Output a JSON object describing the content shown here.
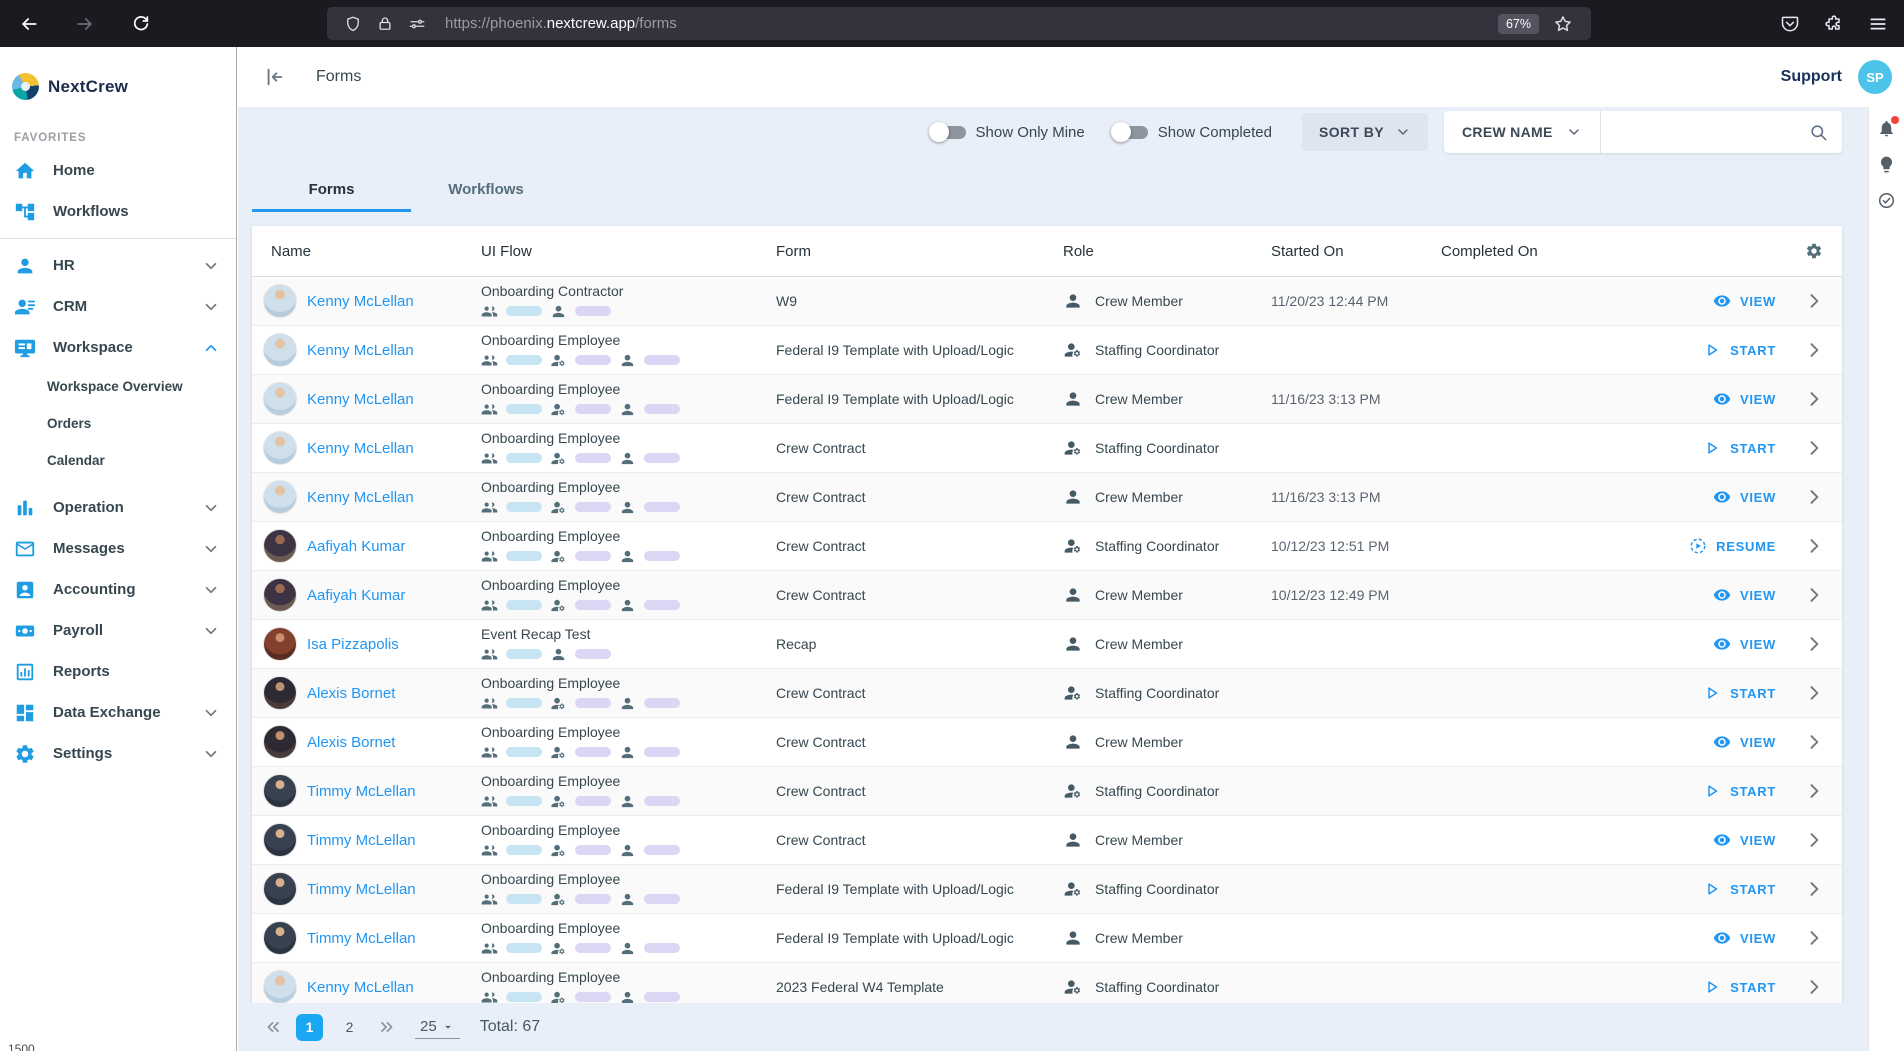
{
  "browser": {
    "url_prefix": "https://phoenix.",
    "url_domain": "nextcrew.app",
    "url_path": "/forms",
    "zoom_badge": "67%"
  },
  "sidebar": {
    "brand": "NextCrew",
    "section_label": "FAVORITES",
    "items": [
      {
        "id": "home",
        "label": "Home",
        "icon": "home",
        "chevron": "none"
      },
      {
        "id": "workflows",
        "label": "Workflows",
        "icon": "workflows",
        "chevron": "none",
        "divider_after": true
      },
      {
        "id": "hr",
        "label": "HR",
        "icon": "person",
        "chevron": "down"
      },
      {
        "id": "crm",
        "label": "CRM",
        "icon": "crm",
        "chevron": "down"
      },
      {
        "id": "workspace",
        "label": "Workspace",
        "icon": "workspace",
        "chevron": "up",
        "children": [
          "Workspace Overview",
          "Orders",
          "Calendar"
        ]
      },
      {
        "id": "operation",
        "label": "Operation",
        "icon": "operation",
        "chevron": "down"
      },
      {
        "id": "messages",
        "label": "Messages",
        "icon": "messages",
        "chevron": "down"
      },
      {
        "id": "accounting",
        "label": "Accounting",
        "icon": "accounting",
        "chevron": "down"
      },
      {
        "id": "payroll",
        "label": "Payroll",
        "icon": "payroll",
        "chevron": "down"
      },
      {
        "id": "reports",
        "label": "Reports",
        "icon": "reports",
        "chevron": "none"
      },
      {
        "id": "data-exchange",
        "label": "Data Exchange",
        "icon": "data-exchange",
        "chevron": "down"
      },
      {
        "id": "settings",
        "label": "Settings",
        "icon": "settings",
        "chevron": "down"
      }
    ]
  },
  "header": {
    "title": "Forms",
    "support_label": "Support",
    "avatar_initials": "SP"
  },
  "filters": {
    "toggles": [
      {
        "label": "Show Only Mine",
        "on": false
      },
      {
        "label": "Show Completed",
        "on": false
      }
    ],
    "sort_button_label": "SORT BY",
    "search_field_label": "CREW NAME",
    "search_value": ""
  },
  "tabs": [
    {
      "label": "Forms",
      "active": true
    },
    {
      "label": "Workflows",
      "active": false
    }
  ],
  "table": {
    "columns": [
      "Name",
      "UI Flow",
      "Form",
      "Role",
      "Started On",
      "Completed On"
    ],
    "flows": {
      "contractor": {
        "title": "Onboarding Contractor",
        "steps": [
          "group-icon",
          "bar-blue",
          "person-icon",
          "bar-purple"
        ]
      },
      "employee": {
        "title": "Onboarding Employee",
        "steps": [
          "group-icon",
          "bar-blue",
          "person-gear-icon",
          "bar-purple",
          "person-icon",
          "bar-purple"
        ]
      },
      "recap": {
        "title": "Event Recap Test",
        "steps": [
          "group-icon",
          "bar-blue",
          "person-icon",
          "bar-purple"
        ]
      }
    },
    "rows": [
      {
        "name": "Kenny McLellan",
        "person": "kenny",
        "flow": "contractor",
        "form": "W9",
        "role": "Crew Member",
        "role_icon": "person",
        "started": "11/20/23 12:44 PM",
        "completed": "",
        "action": "view",
        "action_label": "VIEW"
      },
      {
        "name": "Kenny McLellan",
        "person": "kenny",
        "flow": "employee",
        "form": "Federal I9 Template with Upload/Logic",
        "role": "Staffing Coordinator",
        "role_icon": "person-gear",
        "started": "",
        "completed": "",
        "action": "start",
        "action_label": "START"
      },
      {
        "name": "Kenny McLellan",
        "person": "kenny",
        "flow": "employee",
        "form": "Federal I9 Template with Upload/Logic",
        "role": "Crew Member",
        "role_icon": "person",
        "started": "11/16/23 3:13 PM",
        "completed": "",
        "action": "view",
        "action_label": "VIEW"
      },
      {
        "name": "Kenny McLellan",
        "person": "kenny",
        "flow": "employee",
        "form": "Crew Contract",
        "role": "Staffing Coordinator",
        "role_icon": "person-gear",
        "started": "",
        "completed": "",
        "action": "start",
        "action_label": "START"
      },
      {
        "name": "Kenny McLellan",
        "person": "kenny",
        "flow": "employee",
        "form": "Crew Contract",
        "role": "Crew Member",
        "role_icon": "person",
        "started": "11/16/23 3:13 PM",
        "completed": "",
        "action": "view",
        "action_label": "VIEW"
      },
      {
        "name": "Aafiyah Kumar",
        "person": "aafiyah",
        "flow": "employee",
        "form": "Crew Contract",
        "role": "Staffing Coordinator",
        "role_icon": "person-gear",
        "started": "10/12/23 12:51 PM",
        "completed": "",
        "action": "resume",
        "action_label": "RESUME"
      },
      {
        "name": "Aafiyah Kumar",
        "person": "aafiyah",
        "flow": "employee",
        "form": "Crew Contract",
        "role": "Crew Member",
        "role_icon": "person",
        "started": "10/12/23 12:49 PM",
        "completed": "",
        "action": "view",
        "action_label": "VIEW"
      },
      {
        "name": "Isa Pizzapolis",
        "person": "isa",
        "flow": "recap",
        "form": "Recap",
        "role": "Crew Member",
        "role_icon": "person",
        "started": "",
        "completed": "",
        "action": "view",
        "action_label": "VIEW"
      },
      {
        "name": "Alexis Bornet",
        "person": "alexis",
        "flow": "employee",
        "form": "Crew Contract",
        "role": "Staffing Coordinator",
        "role_icon": "person-gear",
        "started": "",
        "completed": "",
        "action": "start",
        "action_label": "START"
      },
      {
        "name": "Alexis Bornet",
        "person": "alexis",
        "flow": "employee",
        "form": "Crew Contract",
        "role": "Crew Member",
        "role_icon": "person",
        "started": "",
        "completed": "",
        "action": "view",
        "action_label": "VIEW"
      },
      {
        "name": "Timmy McLellan",
        "person": "timmy",
        "flow": "employee",
        "form": "Crew Contract",
        "role": "Staffing Coordinator",
        "role_icon": "person-gear",
        "started": "",
        "completed": "",
        "action": "start",
        "action_label": "START"
      },
      {
        "name": "Timmy McLellan",
        "person": "timmy",
        "flow": "employee",
        "form": "Crew Contract",
        "role": "Crew Member",
        "role_icon": "person",
        "started": "",
        "completed": "",
        "action": "view",
        "action_label": "VIEW"
      },
      {
        "name": "Timmy McLellan",
        "person": "timmy",
        "flow": "employee",
        "form": "Federal I9 Template with Upload/Logic",
        "role": "Staffing Coordinator",
        "role_icon": "person-gear",
        "started": "",
        "completed": "",
        "action": "start",
        "action_label": "START"
      },
      {
        "name": "Timmy McLellan",
        "person": "timmy",
        "flow": "employee",
        "form": "Federal I9 Template with Upload/Logic",
        "role": "Crew Member",
        "role_icon": "person",
        "started": "",
        "completed": "",
        "action": "view",
        "action_label": "VIEW"
      },
      {
        "name": "Kenny McLellan",
        "person": "kenny",
        "flow": "employee",
        "form": "2023 Federal W4 Template",
        "role": "Staffing Coordinator",
        "role_icon": "person-gear",
        "started": "",
        "completed": "",
        "action": "start",
        "action_label": "START"
      }
    ]
  },
  "pagination": {
    "pages": [
      "1",
      "2"
    ],
    "active_page": "1",
    "page_size": "25",
    "total_label": "Total: 67"
  },
  "artifact_text": "1500",
  "colors": {
    "sidebar_icon_blue": "#1e9de3",
    "link_blue": "#2196f3",
    "active_page_blue": "#1aa7f2",
    "avatar_badge_cyan": "#4cc4e9",
    "flow_bar_blue": "#c7e4f2",
    "flow_bar_purple": "#d9d7f3",
    "content_background": "#e9eff8",
    "notification_dot_red": "#f44336"
  }
}
